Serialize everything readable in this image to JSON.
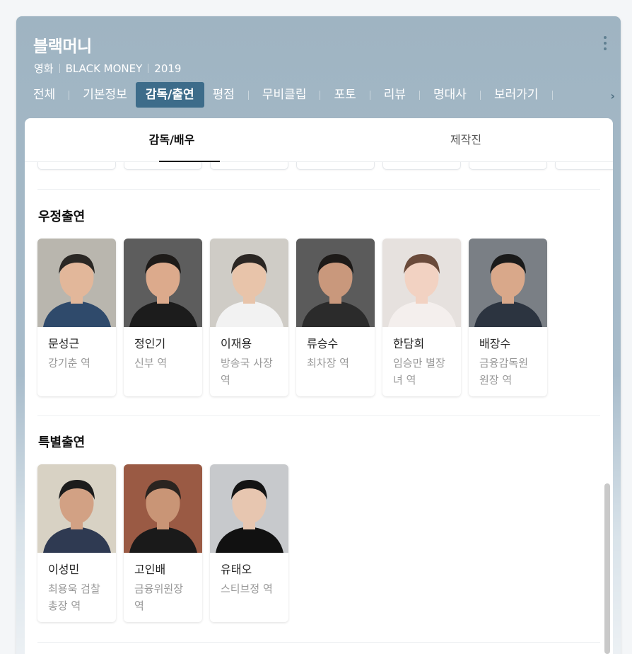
{
  "header": {
    "title": "블랙머니",
    "meta": [
      "영화",
      "BLACK MONEY",
      "2019"
    ],
    "more_icon": "kebab-menu-icon"
  },
  "tabs": [
    {
      "label": "전체",
      "active": false
    },
    {
      "label": "기본정보",
      "active": false
    },
    {
      "label": "감독/출연",
      "active": true
    },
    {
      "label": "평점",
      "active": false
    },
    {
      "label": "무비클립",
      "active": false
    },
    {
      "label": "포토",
      "active": false
    },
    {
      "label": "리뷰",
      "active": false
    },
    {
      "label": "명대사",
      "active": false
    },
    {
      "label": "보러가기",
      "active": false
    }
  ],
  "subtabs": [
    {
      "label": "감독/배우",
      "active": true
    },
    {
      "label": "제작진",
      "active": false
    }
  ],
  "sections": [
    {
      "title": "우정출연",
      "cast": [
        {
          "name": "문성근",
          "role": "강기춘 역"
        },
        {
          "name": "정인기",
          "role": "신부 역"
        },
        {
          "name": "이재용",
          "role": "방송국 사장 역"
        },
        {
          "name": "류승수",
          "role": "최차장 역"
        },
        {
          "name": "한담희",
          "role": "임승만 별장녀 역"
        },
        {
          "name": "배장수",
          "role": "금융감독원 원장 역"
        }
      ]
    },
    {
      "title": "특별출연",
      "cast": [
        {
          "name": "이성민",
          "role": "최용욱 검찰총장 역"
        },
        {
          "name": "고인배",
          "role": "금융위원장 역"
        },
        {
          "name": "유태오",
          "role": "스티브정 역"
        }
      ]
    }
  ]
}
